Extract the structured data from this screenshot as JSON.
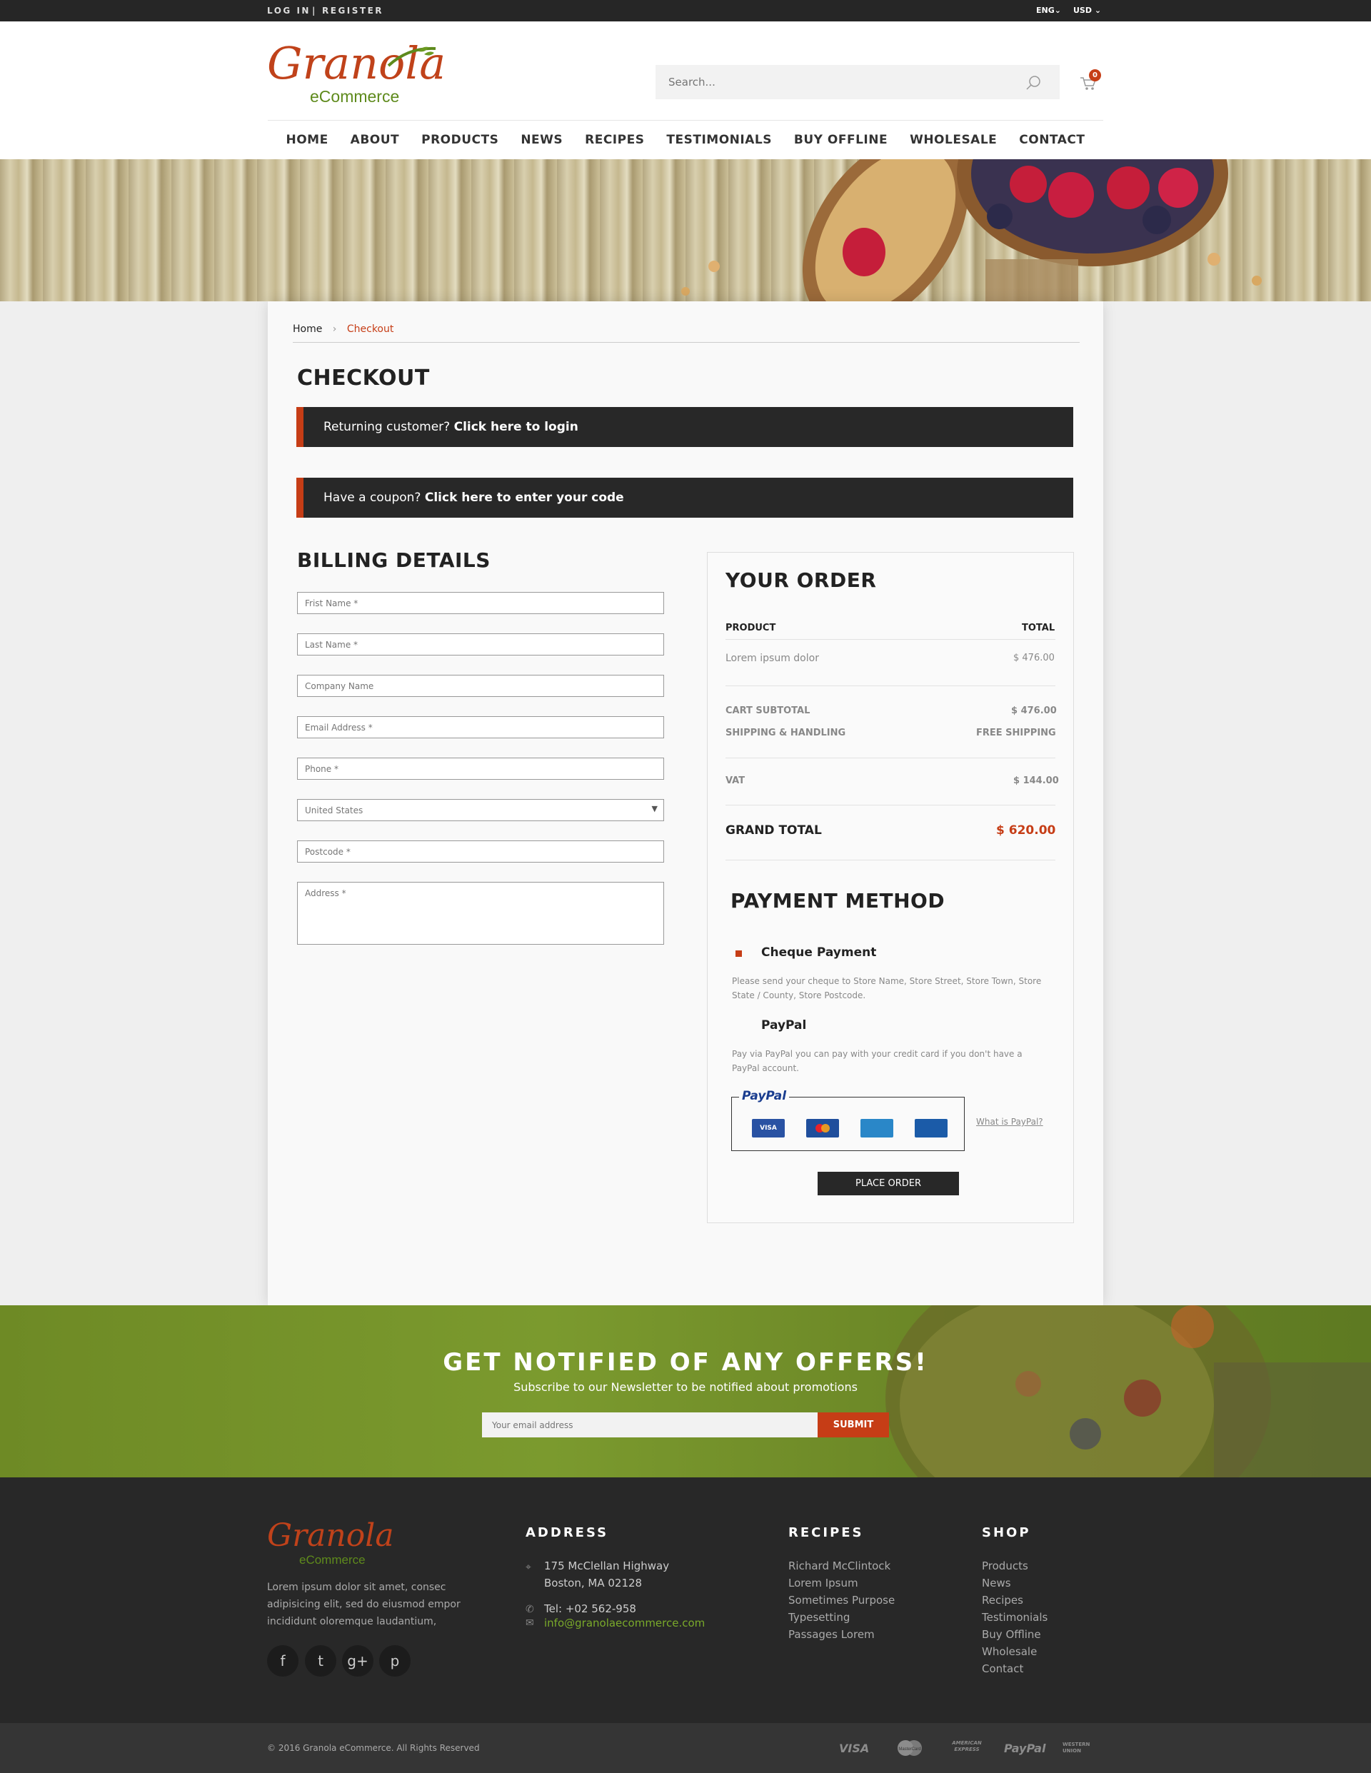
{
  "topbar": {
    "login": "LOG IN",
    "separator": "|",
    "register": "REGISTER",
    "language": "ENG",
    "currency": "USD"
  },
  "logo": {
    "main": "Granola",
    "sub": "eCommerce"
  },
  "search": {
    "placeholder": "Search..."
  },
  "cart": {
    "count": "0"
  },
  "nav": [
    "HOME",
    "ABOUT",
    "PRODUCTS",
    "NEWS",
    "RECIPES",
    "TESTIMONIALS",
    "BUY OFFLINE",
    "WHOLESALE",
    "CONTACT"
  ],
  "breadcrumb": {
    "home": "Home",
    "sep": "›",
    "current": "Checkout"
  },
  "page_title": "CHECKOUT",
  "returning": {
    "text": "Returning customer?",
    "link": "Click here to login"
  },
  "coupon": {
    "text": "Have a coupon?",
    "link": "Click here to enter your code"
  },
  "billing": {
    "title": "BILLING DETAILS",
    "first_name": "Frist Name *",
    "last_name": "Last Name *",
    "company": "Company Name",
    "email": "Email Address *",
    "phone": "Phone *",
    "country": "United States",
    "postcode": "Postcode *",
    "address": "Address *"
  },
  "order": {
    "title": "YOUR ORDER",
    "col_product": "PRODUCT",
    "col_total": "TOTAL",
    "item_name": "Lorem ipsum dolor",
    "item_total": "$ 476.00",
    "subtotal_label": "CART SUBTOTAL",
    "subtotal_value": "$ 476.00",
    "shipping_label": "SHIPPING & HANDLING",
    "shipping_value": "FREE SHIPPING",
    "vat_label": "VAT",
    "vat_value": "$ 144.00",
    "grand_label": "GRAND TOTAL",
    "grand_value": "$ 620.00"
  },
  "payment": {
    "title": "PAYMENT METHOD",
    "cheque_label": "Cheque Payment",
    "cheque_desc": "Please send your cheque to Store Name, Store Street, Store Town, Store State / County, Store Postcode.",
    "paypal_label": "PayPal",
    "paypal_desc": "Pay via PayPal you can pay with your credit card if you don't have a PayPal account.",
    "paypal_logo": "PayPal",
    "cards": [
      "VISA",
      "MC",
      "AMEX",
      "DISC"
    ],
    "what_is": "What is PayPal?",
    "place_order": "PLACE ORDER"
  },
  "newsletter": {
    "title": "GET NOTIFIED OF ANY OFFERS!",
    "subtitle": "Subscribe to our Newsletter to be notified about promotions",
    "placeholder": "Your email address",
    "submit": "SUBMIT"
  },
  "footer": {
    "about": "Lorem ipsum dolor sit amet, consec adipisicing elit, sed do eiusmod empor incididunt oloremque laudantium,",
    "address_title": "ADDRESS",
    "address_line1": "175 McClellan Highway",
    "address_line2": "Boston, MA 02128",
    "tel": "Tel: +02 562-958",
    "email": "info@granolaecommerce.com",
    "recipes_title": "RECIPES",
    "recipes": [
      "Richard McClintock",
      "Lorem Ipsum",
      "Sometimes Purpose",
      "Typesetting",
      "Passages  Lorem"
    ],
    "shop_title": "SHOP",
    "shop": [
      "Products",
      "News",
      "Recipes",
      "Testimonials",
      "Buy Offline",
      "Wholesale",
      "Contact"
    ],
    "copyright": "© 2016 Granola eCommerce. All Rights Reserved",
    "payment_brands": [
      "VISA",
      "MasterCard",
      "AMERICAN EXPRESS",
      "PayPal",
      "WESTERN UNION"
    ]
  },
  "colors": {
    "accent": "#c63d16",
    "dark": "#282828",
    "green": "#5e8a1c"
  }
}
